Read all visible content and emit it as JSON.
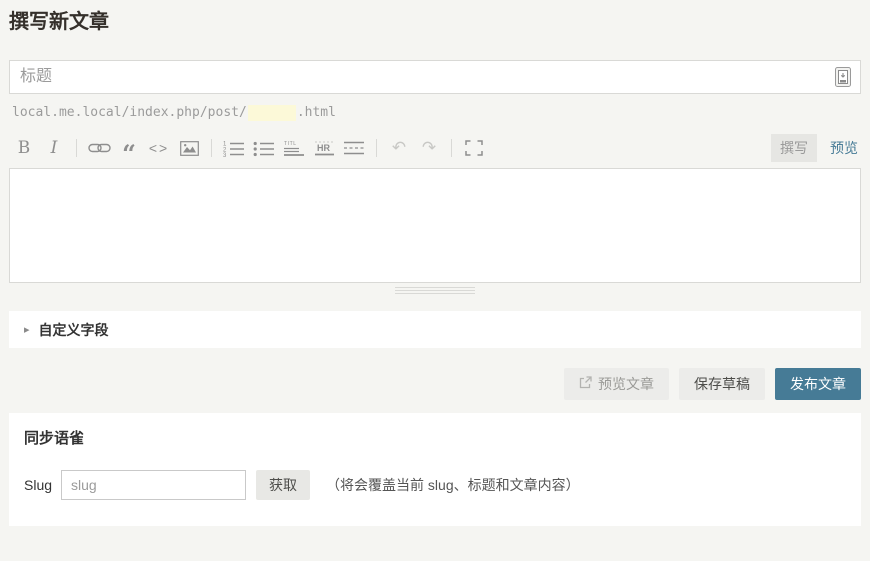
{
  "page": {
    "title": "撰写新文章"
  },
  "title_input": {
    "placeholder": "标题",
    "value": ""
  },
  "permalink": {
    "prefix": "local.me.local/index.php/post/",
    "slug_value": "",
    "suffix": ".html"
  },
  "toolbar": {
    "items": [
      {
        "name": "bold",
        "glyph": "B"
      },
      {
        "name": "italic",
        "glyph": "I"
      },
      {
        "name": "link",
        "glyph": ""
      },
      {
        "name": "blockquote",
        "glyph": "“"
      },
      {
        "name": "code",
        "glyph": "<>"
      },
      {
        "name": "image",
        "glyph": ""
      },
      {
        "name": "ordered-list",
        "glyph": ""
      },
      {
        "name": "unordered-list",
        "glyph": ""
      },
      {
        "name": "heading",
        "glyph": "TITL"
      },
      {
        "name": "horizontal-rule",
        "glyph": "HR"
      },
      {
        "name": "page-break",
        "glyph": ""
      },
      {
        "name": "undo",
        "glyph": "↶"
      },
      {
        "name": "redo",
        "glyph": "↷"
      },
      {
        "name": "fullscreen",
        "glyph": ""
      }
    ]
  },
  "tabs": {
    "write": "撰写",
    "preview": "预览"
  },
  "editor": {
    "value": ""
  },
  "custom_fields": {
    "label": "自定义字段"
  },
  "actions": {
    "preview": "预览文章",
    "save_draft": "保存草稿",
    "publish": "发布文章"
  },
  "yuque": {
    "heading": "同步语雀",
    "slug_label": "Slug",
    "slug_placeholder": "slug",
    "fetch_button": "获取",
    "hint": "（将会覆盖当前 slug、标题和文章内容）"
  },
  "colors": {
    "accent": "#467b96",
    "page_background": "#f5f5f2",
    "slug_highlight": "#fcf9d8",
    "light_button": "#ececea"
  }
}
